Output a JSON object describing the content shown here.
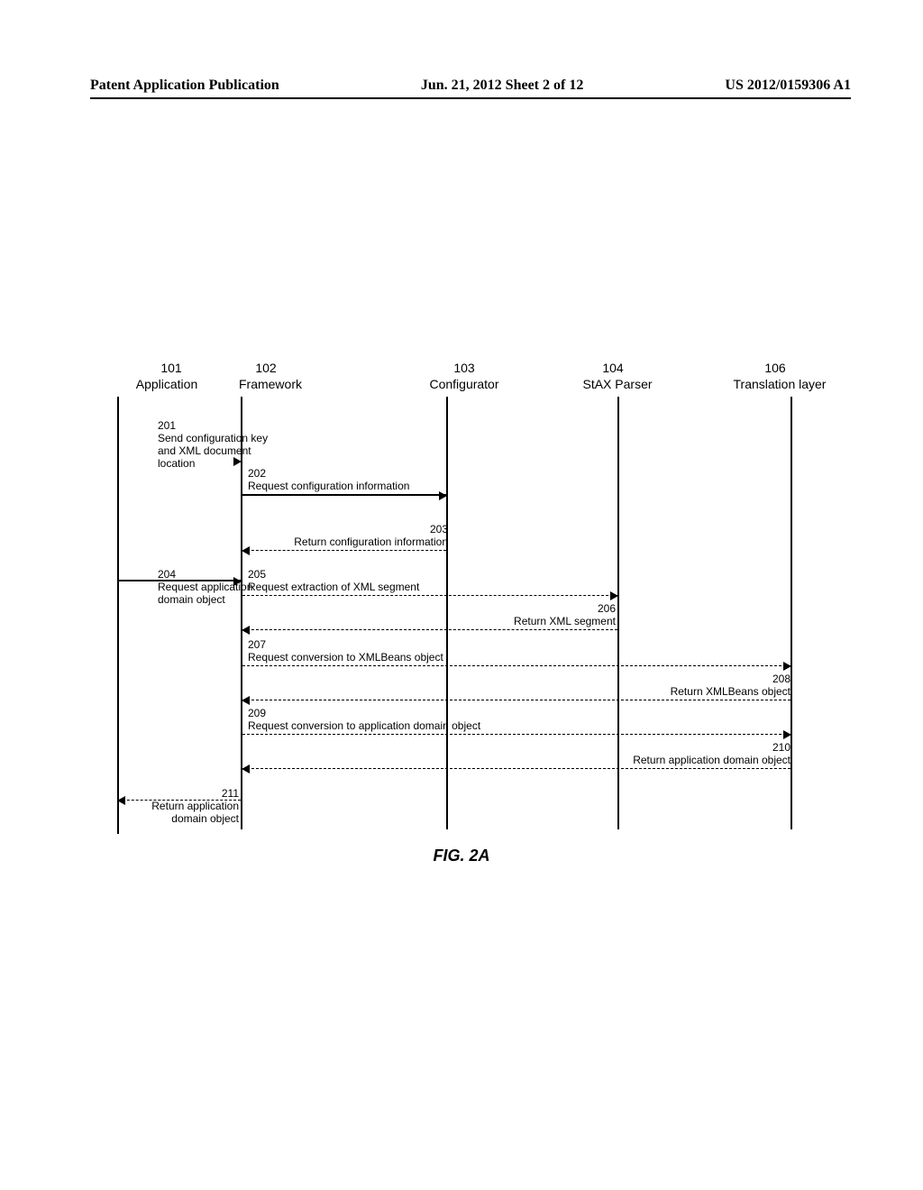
{
  "header": {
    "left": "Patent Application Publication",
    "center": "Jun. 21, 2012  Sheet 2 of 12",
    "right": "US 2012/0159306 A1"
  },
  "lanes": {
    "application": {
      "ref": "101",
      "label": "Application"
    },
    "framework": {
      "ref": "102",
      "label": "Framework"
    },
    "configurator": {
      "ref": "103",
      "label": "Configurator"
    },
    "stax": {
      "ref": "104",
      "label": "StAX Parser"
    },
    "translation": {
      "ref": "106",
      "label": "Translation layer"
    }
  },
  "messages": {
    "m201": {
      "num": "201",
      "text": "Send configuration key and XML document location"
    },
    "m202": {
      "num": "202",
      "text": "Request configuration information"
    },
    "m203": {
      "num": "203",
      "text": "Return configuration information"
    },
    "m204": {
      "num": "204",
      "text": "Request application domain object"
    },
    "m205": {
      "num": "205",
      "text": "Request extraction of XML segment"
    },
    "m206": {
      "num": "206",
      "text": "Return XML segment"
    },
    "m207": {
      "num": "207",
      "text": "Request conversion to XMLBeans object"
    },
    "m208": {
      "num": "208",
      "text": "Return XMLBeans object"
    },
    "m209": {
      "num": "209",
      "text": "Request conversion to application domain object"
    },
    "m210": {
      "num": "210",
      "text": "Return application domain object"
    },
    "m211": {
      "num": "211",
      "text": "Return application domain object"
    }
  },
  "figure_caption": "FIG. 2A"
}
